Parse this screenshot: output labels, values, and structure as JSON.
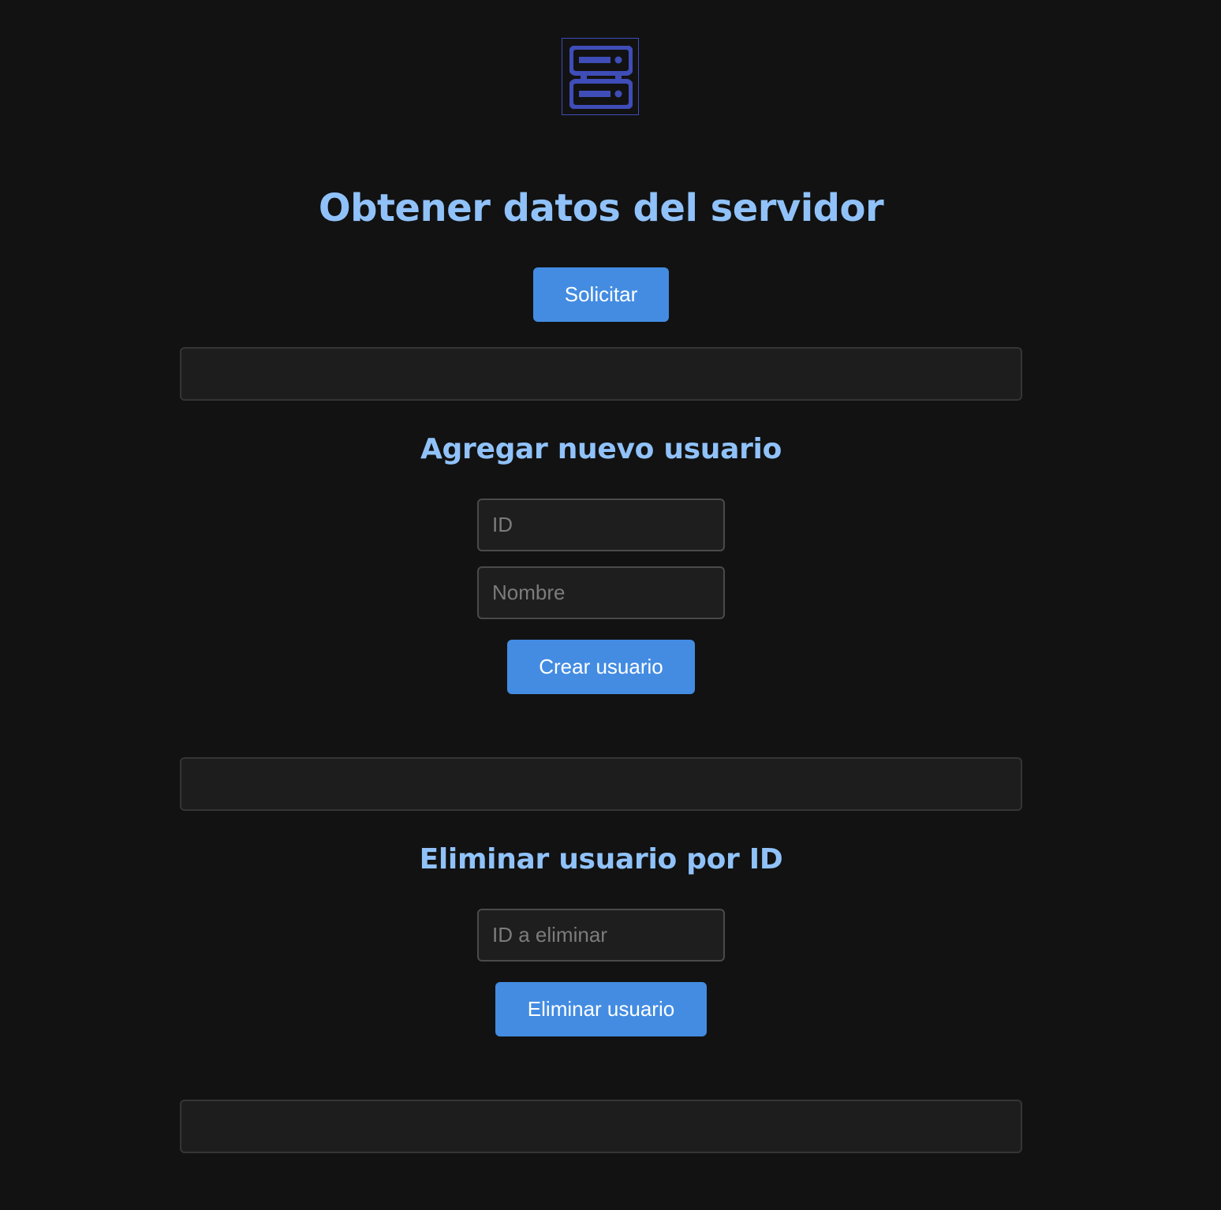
{
  "logo": {
    "icon": "server-icon",
    "color": "#3f4db8"
  },
  "fetch_section": {
    "title": "Obtener datos del servidor",
    "button_label": "Solicitar",
    "result_text": ""
  },
  "add_section": {
    "title": "Agregar nuevo usuario",
    "id_placeholder": "ID",
    "id_value": "",
    "name_placeholder": "Nombre",
    "name_value": "",
    "button_label": "Crear usuario",
    "result_text": ""
  },
  "delete_section": {
    "title": "Eliminar usuario por ID",
    "id_placeholder": "ID a eliminar",
    "id_value": "",
    "button_label": "Eliminar usuario",
    "result_text": ""
  },
  "colors": {
    "background": "#121212",
    "heading": "#90c2f9",
    "button": "#438ce2",
    "button_text": "#ffffff",
    "field_background": "#1e1e1e",
    "field_border": "#4a4a4a",
    "placeholder": "#7c7c7c"
  }
}
